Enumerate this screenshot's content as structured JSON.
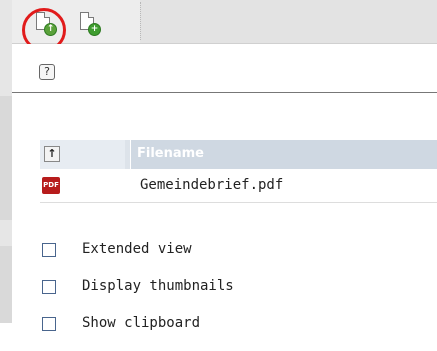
{
  "toolbar": {
    "buttons": [
      {
        "icon": "document-upload-icon"
      },
      {
        "icon": "document-add-icon"
      }
    ],
    "help_icon": "?",
    "help_icon_name": "help-icon",
    "highlight_color": "#e11b1b"
  },
  "file_list": {
    "header_up_icon": "↑",
    "header_filename": "Filename",
    "rows": [
      {
        "icon": "pdf-icon",
        "icon_text": "PDF",
        "name": "Gemeindebrief.pdf"
      }
    ]
  },
  "options": [
    {
      "label": "Extended view",
      "checked": false
    },
    {
      "label": "Display thumbnails",
      "checked": false
    },
    {
      "label": "Show clipboard",
      "checked": false
    }
  ]
}
